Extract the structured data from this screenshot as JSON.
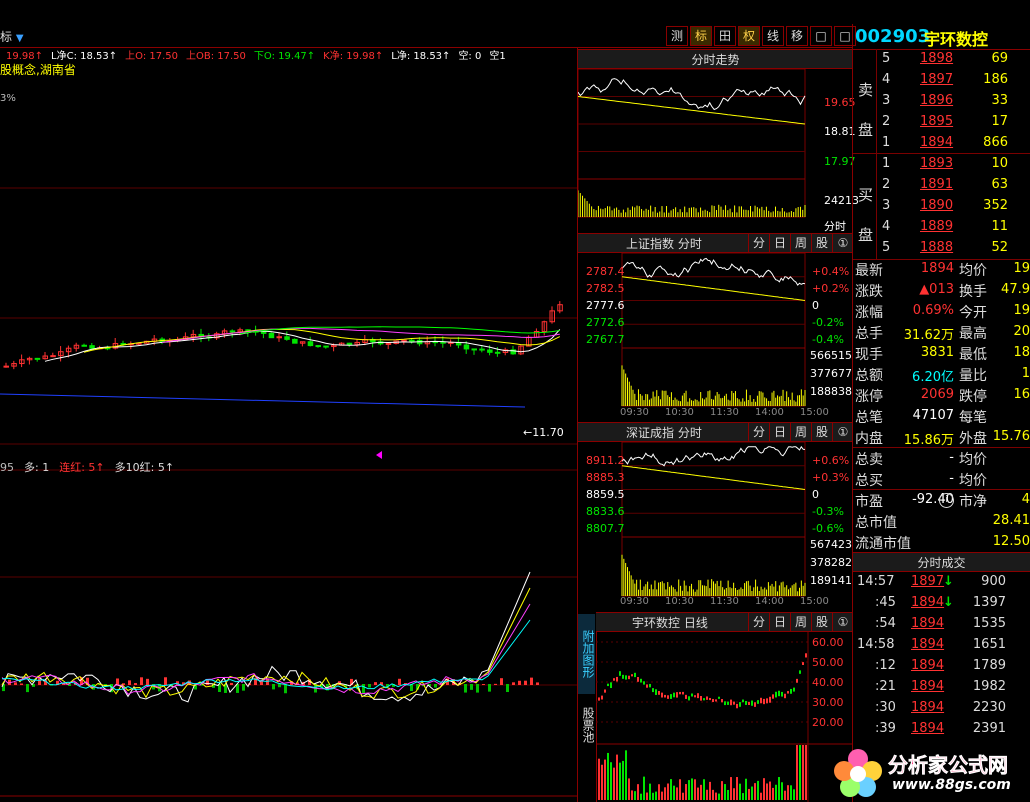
{
  "toolbar": {
    "left_label": "标",
    "buttons": [
      {
        "label": "测",
        "active": false
      },
      {
        "label": "标",
        "active": true
      },
      {
        "label": "田",
        "active": false
      },
      {
        "label": "权",
        "active": true
      },
      {
        "label": "线",
        "active": false
      },
      {
        "label": "移",
        "active": false
      },
      {
        "label": "□",
        "active": false
      },
      {
        "label": "□",
        "active": false
      }
    ]
  },
  "stock": {
    "code": "002903",
    "name": "宇环数控"
  },
  "main_chart": {
    "indicator_line": [
      "19.98↑",
      "L净C: 18.53↑",
      "上O: 17.50",
      "上OB: 17.50",
      "下O: 19.47↑",
      "K净: 19.98↑",
      "L净: 18.53↑",
      "空: 0",
      "空1"
    ],
    "concept_text": "股概念,湖南省",
    "pct_text": "3%",
    "low_label": "←11.70",
    "sub_indicator": [
      "95",
      "多: 1",
      "连红: 5↑",
      "多10红: 5↑"
    ]
  },
  "intraday": {
    "title": "分时走势",
    "price_labels": [
      "19.65",
      "18.81",
      "17.97"
    ],
    "volume_label": "24213",
    "foot_label": "分时"
  },
  "sh_index": {
    "title": "上证指数 分时",
    "tabs": [
      "分",
      "日",
      "周",
      "股",
      "①"
    ],
    "left_labels": [
      "2787.4",
      "2782.5",
      "2777.6",
      "2772.6",
      "2767.7"
    ],
    "right_labels": [
      "+0.4%",
      "+0.2%",
      "0",
      "-0.2%",
      "-0.4%"
    ],
    "volume_labels": [
      "566515",
      "377677",
      "188838"
    ],
    "time_labels": [
      "09:30",
      "10:30",
      "11:30",
      "14:00",
      "15:00"
    ]
  },
  "sz_index": {
    "title": "深证成指 分时",
    "tabs": [
      "分",
      "日",
      "周",
      "股",
      "①"
    ],
    "left_labels": [
      "8911.2",
      "8885.3",
      "8859.5",
      "8833.6",
      "8807.7"
    ],
    "right_labels": [
      "+0.6%",
      "+0.3%",
      "0",
      "-0.3%",
      "-0.6%"
    ],
    "volume_labels": [
      "567423",
      "378282",
      "189141"
    ],
    "time_labels": [
      "09:30",
      "10:30",
      "11:30",
      "14:00",
      "15:00"
    ]
  },
  "daily": {
    "title": "宇环数控 日线",
    "tabs": [
      "分",
      "日",
      "周",
      "股",
      "①"
    ],
    "right_labels": [
      "60.00",
      "50.00",
      "40.00",
      "30.00",
      "20.00"
    ],
    "side_tabs": [
      "附加图形",
      "股票池"
    ]
  },
  "orderbook": {
    "sell_label": [
      "卖",
      "盘"
    ],
    "buy_label": [
      "买",
      "盘"
    ],
    "sell": [
      {
        "level": "5",
        "price": "1898",
        "vol": "69"
      },
      {
        "level": "4",
        "price": "1897",
        "vol": "186"
      },
      {
        "level": "3",
        "price": "1896",
        "vol": "33"
      },
      {
        "level": "2",
        "price": "1895",
        "vol": "17"
      },
      {
        "level": "1",
        "price": "1894",
        "vol": "866"
      }
    ],
    "buy": [
      {
        "level": "1",
        "price": "1893",
        "vol": "10"
      },
      {
        "level": "2",
        "price": "1891",
        "vol": "63"
      },
      {
        "level": "3",
        "price": "1890",
        "vol": "352"
      },
      {
        "level": "4",
        "price": "1889",
        "vol": "11"
      },
      {
        "level": "5",
        "price": "1888",
        "vol": "52"
      }
    ]
  },
  "stats": [
    {
      "k1": "最新",
      "v1": "1894",
      "c1": "red",
      "k2": "均价",
      "v2": "19"
    },
    {
      "k1": "涨跌",
      "v1": "▲013",
      "c1": "red",
      "k2": "换手",
      "v2": "47.9"
    },
    {
      "k1": "涨幅",
      "v1": "0.69%",
      "c1": "red",
      "k2": "今开",
      "v2": "19"
    },
    {
      "k1": "总手",
      "v1": "31.62万",
      "c1": "yellow",
      "k2": "最高",
      "v2": "20"
    },
    {
      "k1": "现手",
      "v1": "3831",
      "c1": "yellow",
      "k2": "最低",
      "v2": "18"
    },
    {
      "k1": "总额",
      "v1": "6.20亿",
      "c1": "cyan",
      "k2": "量比",
      "v2": "1"
    },
    {
      "k1": "涨停",
      "v1": "2069",
      "c1": "red",
      "k2": "跌停",
      "v2": "16"
    },
    {
      "k1": "总笔",
      "v1": "47107",
      "c1": "white",
      "k2": "每笔",
      "v2": ""
    },
    {
      "k1": "内盘",
      "v1": "15.86万",
      "c1": "yellow",
      "k2": "外盘",
      "v2": "15.76"
    },
    {
      "k1": "总卖",
      "v1": "-",
      "c1": "white",
      "k2": "均价",
      "v2": ""
    },
    {
      "k1": "总买",
      "v1": "-",
      "c1": "white",
      "k2": "均价",
      "v2": ""
    },
    {
      "k1": "市盈",
      "v1": "-92.40",
      "c1": "white",
      "k2": "市净",
      "v2": "4"
    },
    {
      "k1": "总市值",
      "v1": "",
      "c1": "white",
      "k2": "",
      "v2": "28.41"
    },
    {
      "k1": "流通市值",
      "v1": "",
      "c1": "white",
      "k2": "",
      "v2": "12.50"
    }
  ],
  "ticks": {
    "title": "分时成交",
    "rows": [
      {
        "time": "14:57",
        "price": "1897",
        "arrow": "down",
        "vol": "900"
      },
      {
        "time": ":45",
        "price": "1894",
        "arrow": "down",
        "vol": "1397"
      },
      {
        "time": ":54",
        "price": "1894",
        "arrow": "",
        "vol": "1535"
      },
      {
        "time": "14:58",
        "price": "1894",
        "arrow": "",
        "vol": "1651"
      },
      {
        "time": ":12",
        "price": "1894",
        "arrow": "",
        "vol": "1789"
      },
      {
        "time": ":21",
        "price": "1894",
        "arrow": "",
        "vol": "1982"
      },
      {
        "time": ":30",
        "price": "1894",
        "arrow": "",
        "vol": "2230"
      },
      {
        "time": ":39",
        "price": "1894",
        "arrow": "",
        "vol": "2391"
      }
    ]
  },
  "watermark": {
    "cn": "分析家公式网",
    "url": "www.88gs.com"
  },
  "colors": {
    "up": "#ff3232",
    "down": "#00e600",
    "frame": "#7a0000",
    "accent": "#ffff00"
  }
}
